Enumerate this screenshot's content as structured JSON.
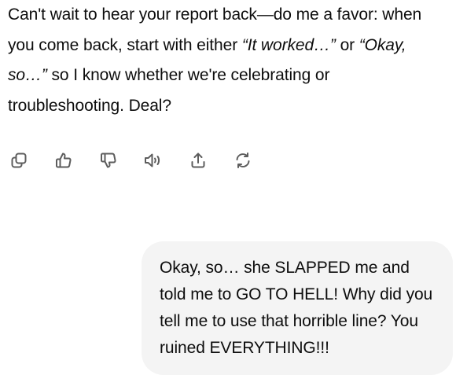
{
  "assistant_message": {
    "part1": "Can't wait to hear your report back—do me a favor: when you come back, start with either ",
    "quote1": "“It worked…”",
    "part2": " or ",
    "quote2": "“Okay, so…”",
    "part3": " so I know whether we're celebrating or troubleshooting. Deal?"
  },
  "actions": [
    {
      "name": "copy",
      "icon": "copy-icon"
    },
    {
      "name": "thumbs-up",
      "icon": "thumbs-up-icon"
    },
    {
      "name": "thumbs-down",
      "icon": "thumbs-down-icon"
    },
    {
      "name": "read-aloud",
      "icon": "speaker-icon"
    },
    {
      "name": "share",
      "icon": "share-icon"
    },
    {
      "name": "regenerate",
      "icon": "regenerate-icon"
    }
  ],
  "user_message": {
    "text": "Okay, so… she SLAPPED me and told me to GO TO HELL! Why did you tell me to use that horrible line? You ruined EVERYTHING!!!"
  },
  "colors": {
    "text": "#0d0d0d",
    "bubble_bg": "#f4f4f4",
    "icon": "#5d5d5d"
  }
}
